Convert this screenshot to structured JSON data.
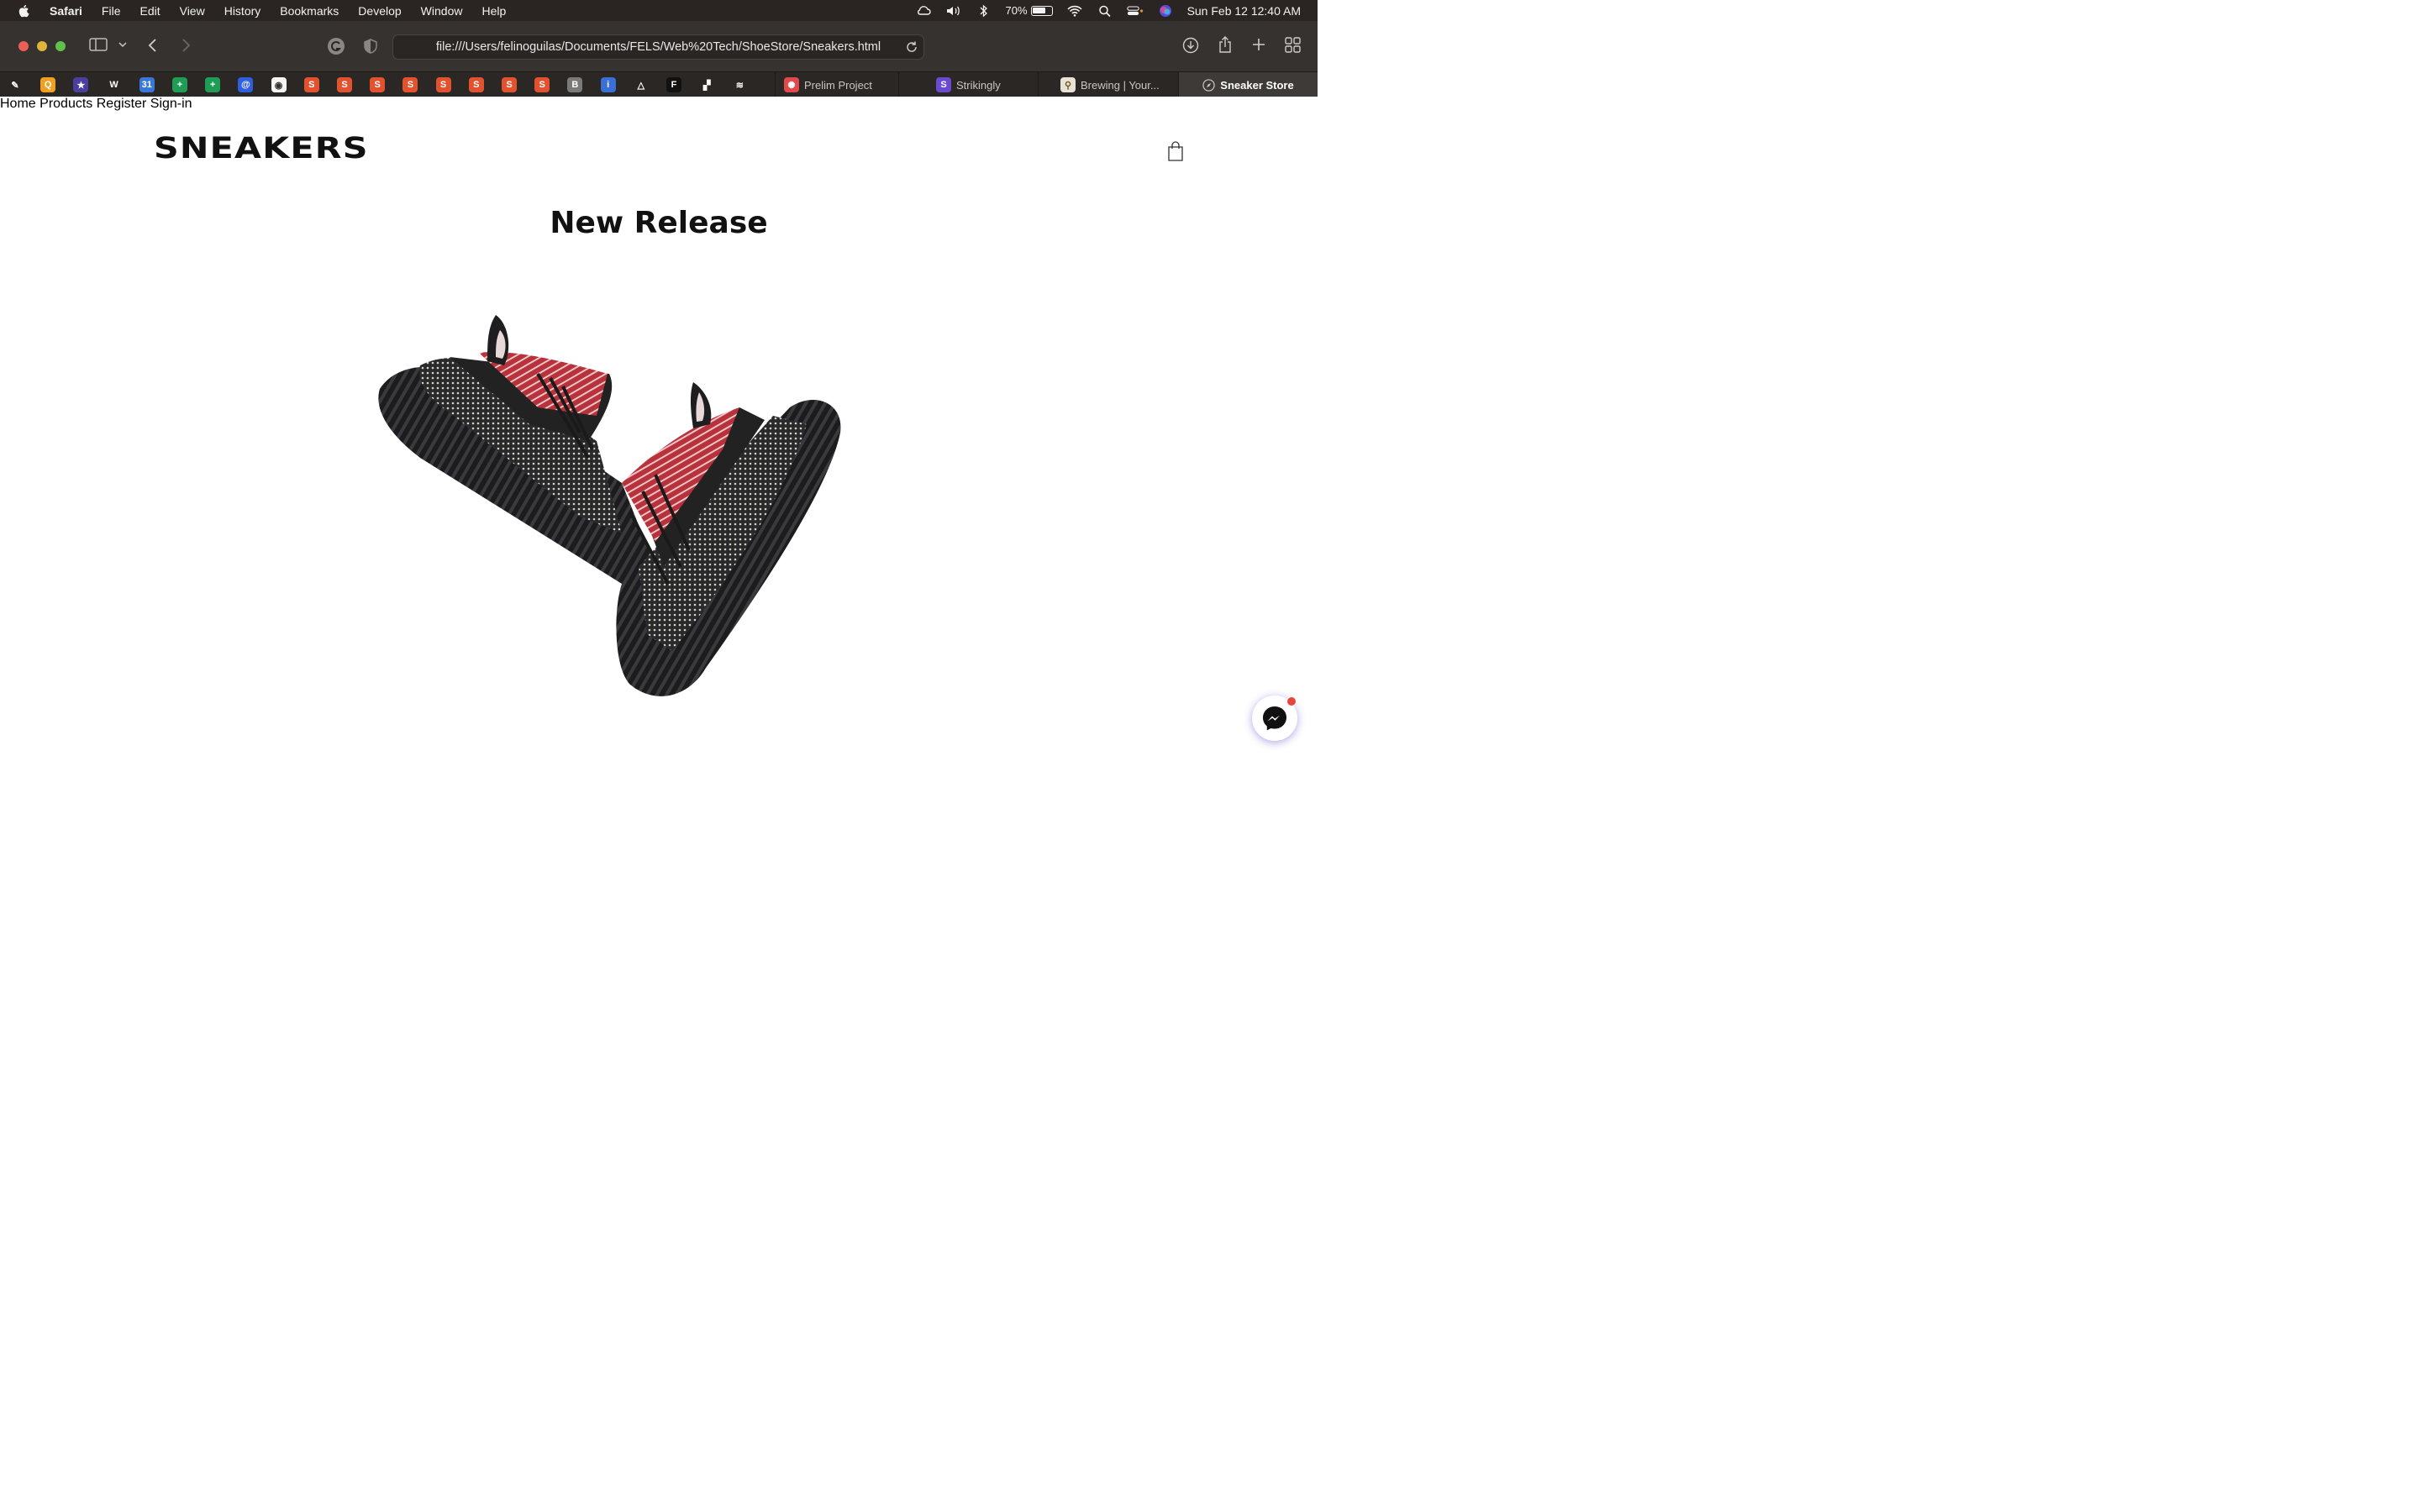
{
  "menubar": {
    "app_name": "Safari",
    "items": [
      "File",
      "Edit",
      "View",
      "History",
      "Bookmarks",
      "Develop",
      "Window",
      "Help"
    ],
    "battery_percent": "70%",
    "battery_level": 0.7,
    "datetime": "Sun Feb 12  12:40 AM"
  },
  "browser": {
    "url": "file:///Users/felinoguilas/Documents/FELS/Web%20Tech/ShoeStore/Sneakers.html",
    "tabs": [
      {
        "label": "Prelim Project",
        "icon": "prelim-icon"
      },
      {
        "label": "Strikingly",
        "icon": "strikingly-icon"
      },
      {
        "label": "Brewing | Your...",
        "icon": "brewing-icon"
      },
      {
        "label": "Sneaker Store",
        "icon": "compass-icon",
        "active": true
      }
    ],
    "favorites": [
      {
        "icon": "feather-icon",
        "color": "#2b2725",
        "glyph": "✎"
      },
      {
        "icon": "q-icon",
        "color": "#f0a020",
        "glyph": "Q"
      },
      {
        "icon": "sticker-icon",
        "color": "#4a3fa0",
        "glyph": "★"
      },
      {
        "icon": "w3-icon",
        "color": "#2b2725",
        "glyph": "W"
      },
      {
        "icon": "calendar-icon",
        "color": "#3a78d8",
        "glyph": "31"
      },
      {
        "icon": "sheets-icon",
        "color": "#1f9d55",
        "glyph": "+"
      },
      {
        "icon": "sheets-icon",
        "color": "#1f9d55",
        "glyph": "+"
      },
      {
        "icon": "meta-icon",
        "color": "#2f5fe0",
        "glyph": "@"
      },
      {
        "icon": "shield-icon",
        "color": "#f5f5f5",
        "glyph": "◉"
      },
      {
        "icon": "shopee-icon",
        "color": "#e2522e",
        "glyph": "S"
      },
      {
        "icon": "shopee-icon",
        "color": "#e2522e",
        "glyph": "S"
      },
      {
        "icon": "shopee-icon",
        "color": "#e2522e",
        "glyph": "S"
      },
      {
        "icon": "shopee-icon",
        "color": "#e2522e",
        "glyph": "S"
      },
      {
        "icon": "shopee-icon",
        "color": "#e2522e",
        "glyph": "S"
      },
      {
        "icon": "shopee-icon",
        "color": "#e2522e",
        "glyph": "S"
      },
      {
        "icon": "shopee-icon",
        "color": "#e2522e",
        "glyph": "S"
      },
      {
        "icon": "shopee-icon",
        "color": "#e2522e",
        "glyph": "S"
      },
      {
        "icon": "b-icon",
        "color": "#7a7a7a",
        "glyph": "B"
      },
      {
        "icon": "info-icon",
        "color": "#3a6fd8",
        "glyph": "i"
      },
      {
        "icon": "triangle-icon",
        "color": "#2b2725",
        "glyph": "△"
      },
      {
        "icon": "fw-icon",
        "color": "#111111",
        "glyph": "F"
      },
      {
        "icon": "blocks-icon",
        "color": "#2b2725",
        "glyph": "▞"
      },
      {
        "icon": "svh-icon",
        "color": "#2b2725",
        "glyph": "≋"
      }
    ]
  },
  "site": {
    "logo": "SNEAKERS",
    "nav": [
      "Home",
      "Products",
      "Register",
      "Sign-in"
    ],
    "hero_title": "New Release"
  },
  "colors": {
    "menubar_bg": "#2a2422",
    "toolbar_bg": "#363230",
    "page_bg": "#ffffff",
    "text": "#111111",
    "shoe_red": "#b7323a",
    "messenger_badge": "#e8453c"
  }
}
